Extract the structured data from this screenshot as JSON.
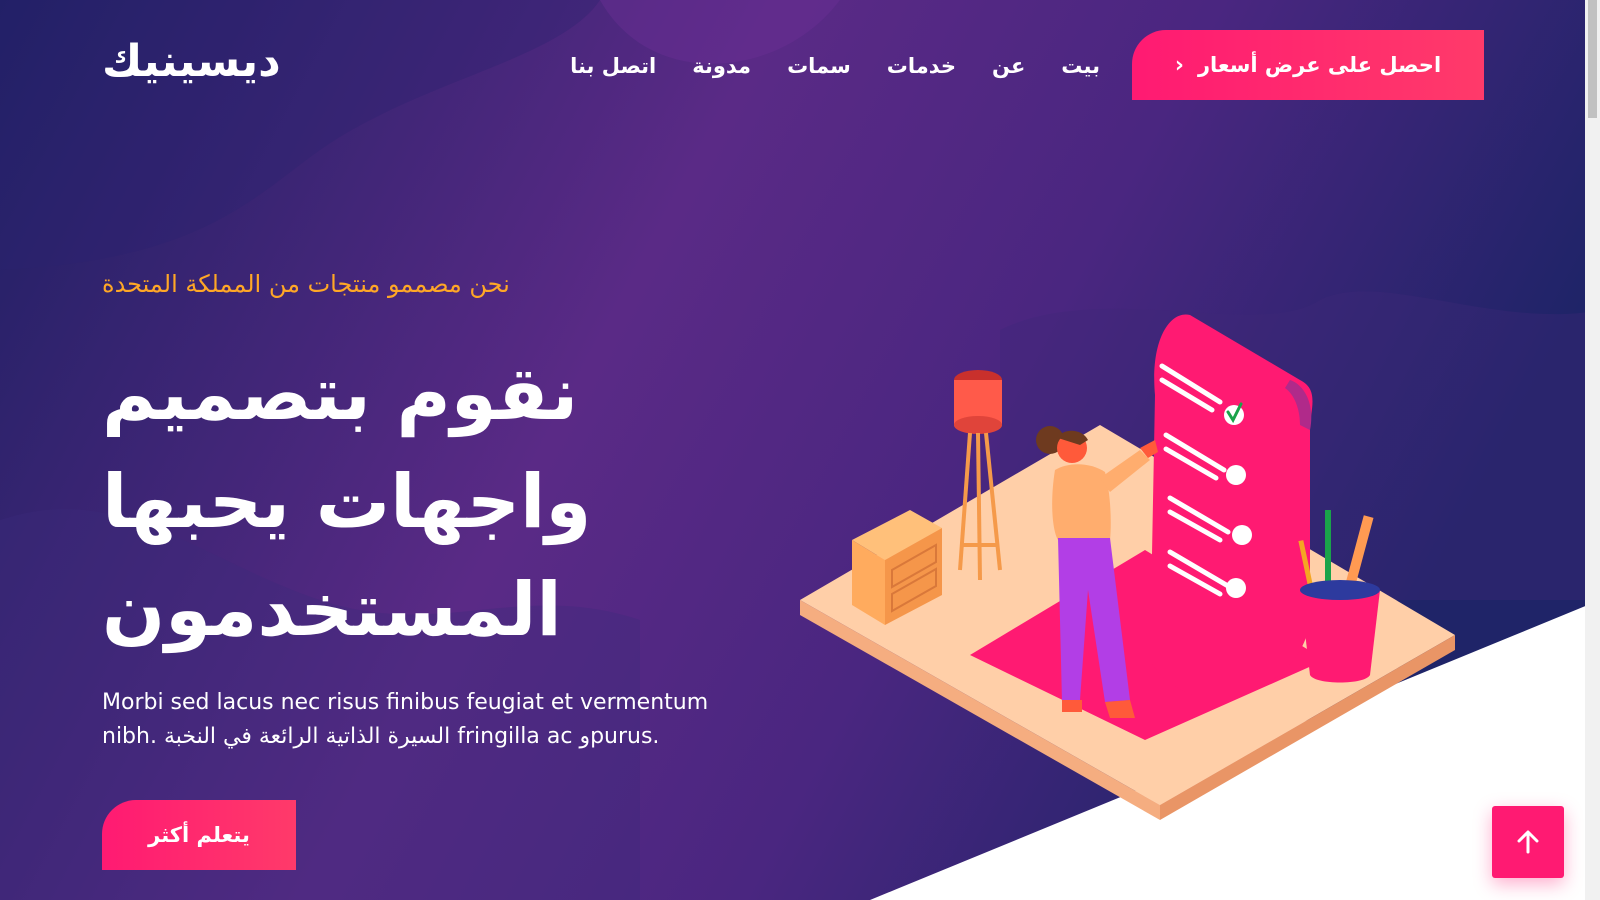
{
  "header": {
    "logo": "ديسينيك",
    "nav": [
      {
        "label": "بيت"
      },
      {
        "label": "عن"
      },
      {
        "label": "خدمات"
      },
      {
        "label": "سمات"
      },
      {
        "label": "مدونة"
      },
      {
        "label": "اتصل بنا"
      }
    ],
    "quote_button": {
      "label": "احصل على عرض أسعار",
      "icon": "chevron-left-icon"
    }
  },
  "hero": {
    "subtitle": "نحن مصممو منتجات من المملكة المتحدة",
    "headline_lines": [
      "نقوم بتصميم",
      "واجهات يحبها",
      "المستخدمون"
    ],
    "description": "Morbi sed lacus nec risus finibus feugiat et vermentum nibh. السيرة الذاتية الرائعة في النخبة fringilla ac وpurus.",
    "learn_more": "يتعلم أكثر"
  },
  "back_to_top": {
    "icon": "arrow-up-icon"
  },
  "colors": {
    "accent": "#ff1a72",
    "subtitle": "#ffa726",
    "bg_dark": "#1c1f5e",
    "bg_purple": "#5b2a85"
  }
}
